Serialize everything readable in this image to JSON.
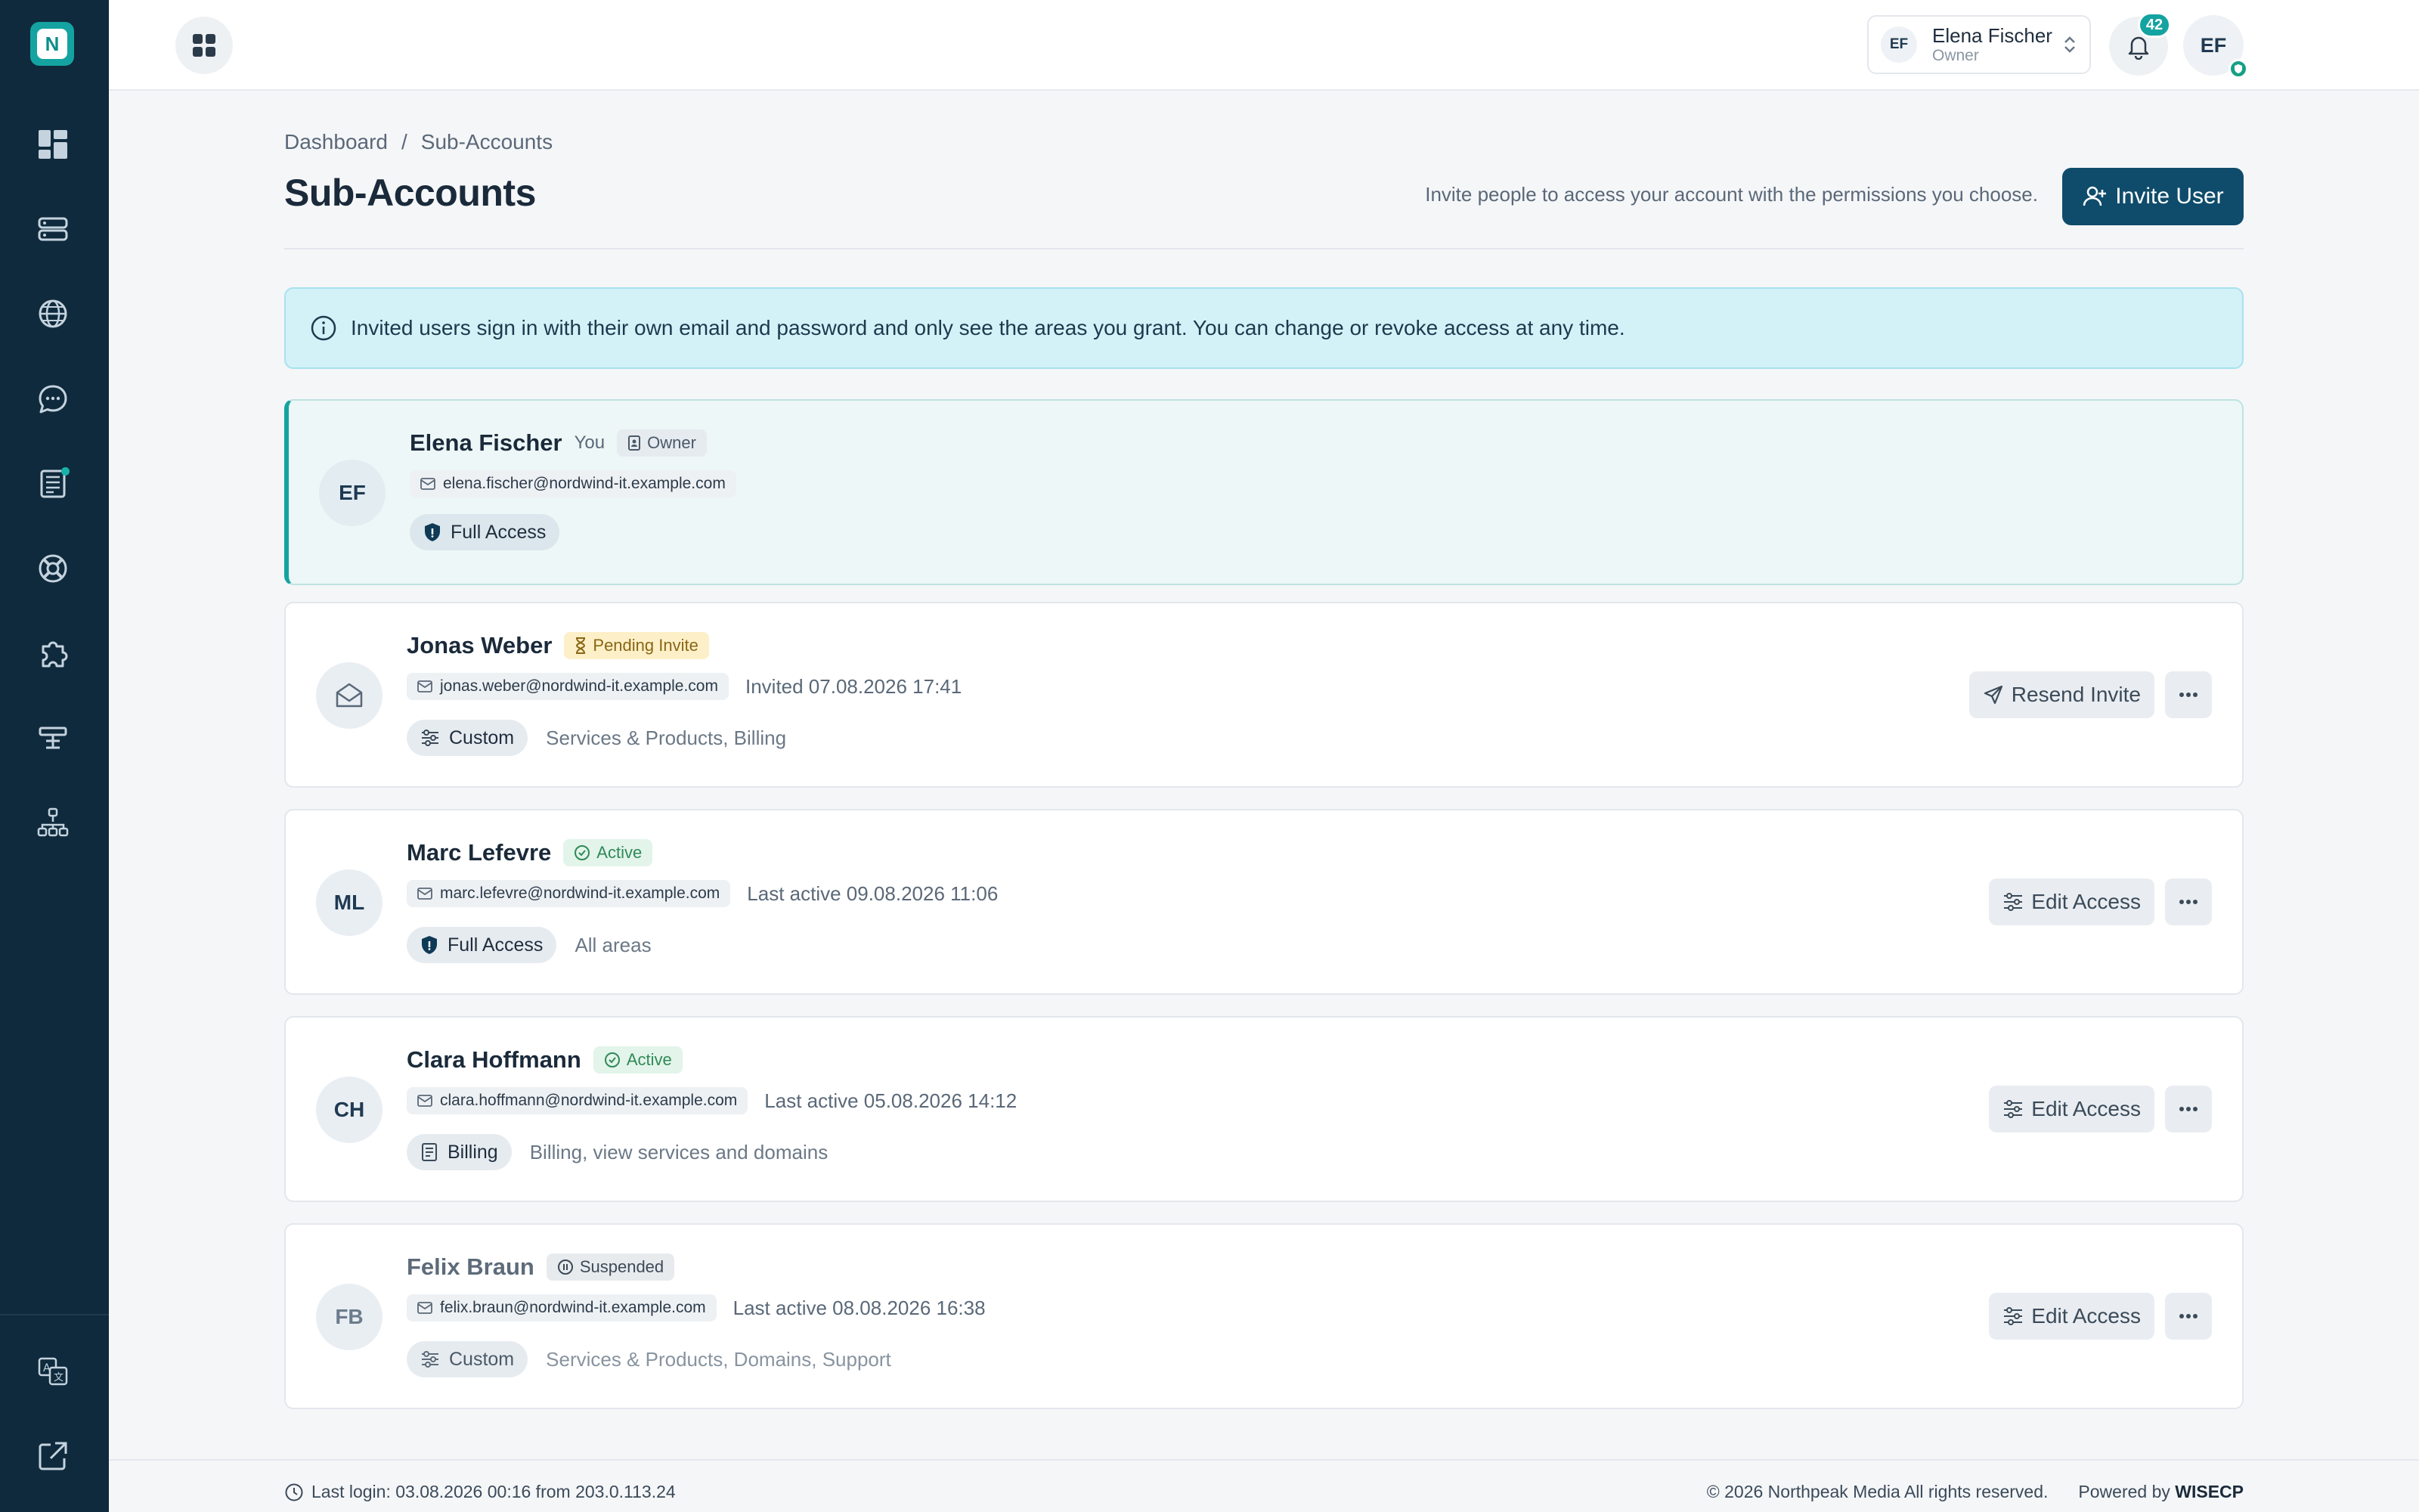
{
  "app": {
    "logo_letter": "N"
  },
  "topbar": {
    "account": {
      "initials": "EF",
      "name": "Elena Fischer",
      "role": "Owner"
    },
    "notifications_count": "42",
    "user_initials": "EF"
  },
  "sidebar": {
    "items": [
      {
        "name": "dashboard",
        "icon": "dashboard-icon"
      },
      {
        "name": "services",
        "icon": "server-icon"
      },
      {
        "name": "domains",
        "icon": "globe-icon"
      },
      {
        "name": "messages",
        "icon": "chat-icon"
      },
      {
        "name": "invoices",
        "icon": "invoice-icon",
        "has_dot": true
      },
      {
        "name": "support",
        "icon": "lifebuoy-icon"
      },
      {
        "name": "addons",
        "icon": "puzzle-icon"
      },
      {
        "name": "tools",
        "icon": "tools-icon"
      },
      {
        "name": "affiliate",
        "icon": "sitemap-icon"
      }
    ],
    "bottom": [
      {
        "name": "language",
        "icon": "translate-icon"
      },
      {
        "name": "external",
        "icon": "external-link-icon"
      }
    ]
  },
  "breadcrumb": {
    "home": "Dashboard",
    "separator": "/",
    "current": "Sub-Accounts"
  },
  "page": {
    "title": "Sub-Accounts",
    "invite_description": "Invite people to access your account with the permissions you choose.",
    "invite_button": "Invite User"
  },
  "info_banner": "Invited users sign in with their own email and password and only see the areas you grant. You can change or revoke access at any time.",
  "users": [
    {
      "initials": "EF",
      "name": "Elena Fischer",
      "you_label": "You",
      "status": "Owner",
      "email": "elena.fischer@nordwind-it.example.com",
      "meta": "",
      "access": "Full Access",
      "access_desc": "",
      "actions": []
    },
    {
      "initials": "",
      "name": "Jonas Weber",
      "status": "Pending Invite",
      "email": "jonas.weber@nordwind-it.example.com",
      "meta": "Invited 07.08.2026 17:41",
      "access": "Custom",
      "access_desc": "Services & Products, Billing",
      "action_label": "Resend Invite"
    },
    {
      "initials": "ML",
      "name": "Marc Lefevre",
      "status": "Active",
      "email": "marc.lefevre@nordwind-it.example.com",
      "meta": "Last active 09.08.2026 11:06",
      "access": "Full Access",
      "access_desc": "All areas",
      "action_label": "Edit Access"
    },
    {
      "initials": "CH",
      "name": "Clara Hoffmann",
      "status": "Active",
      "email": "clara.hoffmann@nordwind-it.example.com",
      "meta": "Last active 05.08.2026 14:12",
      "access": "Billing",
      "access_desc": "Billing, view services and domains",
      "action_label": "Edit Access"
    },
    {
      "initials": "FB",
      "name": "Felix Braun",
      "status": "Suspended",
      "email": "felix.braun@nordwind-it.example.com",
      "meta": "Last active 08.08.2026 16:38",
      "access": "Custom",
      "access_desc": "Services & Products, Domains, Support",
      "action_label": "Edit Access"
    }
  ],
  "footer": {
    "last_login": "Last login: 03.08.2026 00:16 from 203.0.113.24",
    "copyright": "© 2026 Northpeak Media All rights reserved.",
    "powered_by": "Powered by",
    "powered_brand": "WISECP"
  },
  "colors": {
    "sidebar": "#0f2a3d",
    "accent": "#14a3a0",
    "primary_button": "#0f4c6b",
    "info_banner": "#d2f2f8"
  }
}
